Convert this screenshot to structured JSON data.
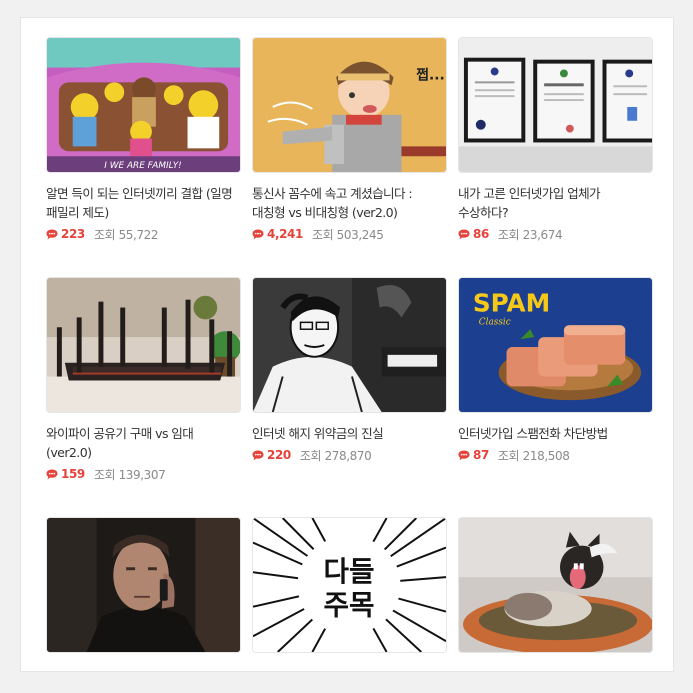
{
  "colors": {
    "accent": "#e5423a",
    "meta": "#8a8a8a",
    "title": "#333333"
  },
  "views_label": "조회",
  "cards": [
    {
      "title": "알면 득이 되는 인터넷끼리 결합 (일명 패밀리 제도)",
      "comments": "223",
      "views": "55,722",
      "image_text": "I WE ARE FAMILY!"
    },
    {
      "title": "통신사 꼼수에 속고 계셨습니다 : 대칭형 vs 비대칭형 (ver2.0)",
      "comments": "4,241",
      "views": "503,245",
      "image_text": "쩝..."
    },
    {
      "title": "내가 고른 인터넷가입 업체가 수상하다?",
      "comments": "86",
      "views": "23,674"
    },
    {
      "title": "와이파이 공유기 구매 vs 임대 (ver2.0)",
      "comments": "159",
      "views": "139,307"
    },
    {
      "title": "인터넷 해지 위약금의 진실",
      "comments": "220",
      "views": "278,870"
    },
    {
      "title": "인터넷가입 스팸전화 차단방법",
      "comments": "87",
      "views": "218,508",
      "image_text": "SPAM",
      "image_subtext": "Classic"
    },
    {
      "title": "",
      "comments": "",
      "views": ""
    },
    {
      "title": "",
      "comments": "",
      "views": "",
      "image_text_1": "다들",
      "image_text_2": "주목"
    },
    {
      "title": "",
      "comments": "",
      "views": ""
    }
  ]
}
